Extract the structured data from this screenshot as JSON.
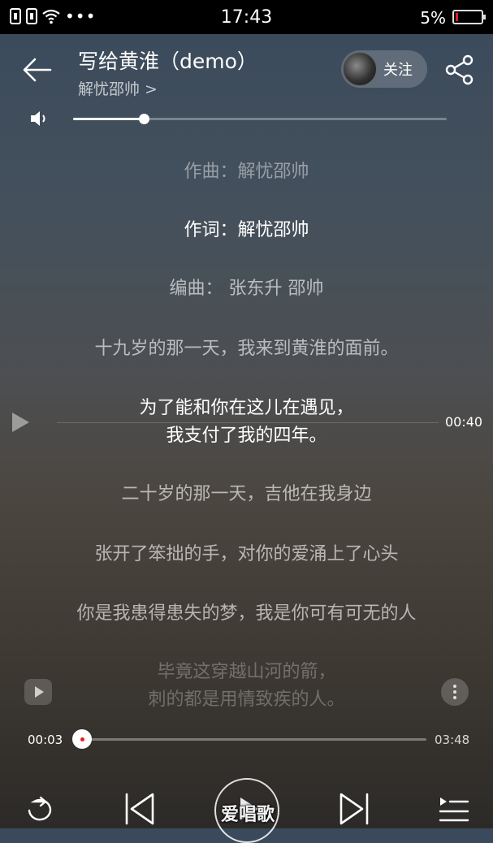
{
  "status_bar": {
    "time": "17:43",
    "battery": "5%"
  },
  "header": {
    "title": "写给黄淮（demo）",
    "artist": "解忧邵帅 >",
    "follow_label": "关注"
  },
  "volume": {
    "level_percent": 19
  },
  "lyrics": [
    {
      "text": "作曲：解忧邵帅",
      "state": "dim"
    },
    {
      "text": "作词：解忧邵帅",
      "state": "active"
    },
    {
      "text": "编曲：   张东升 邵帅",
      "state": "mid"
    },
    {
      "text": "十九岁的那一天，我来到黄淮的面前。",
      "state": "mid"
    },
    {
      "text": "为了能和你在这儿在遇见，",
      "state": "active"
    },
    {
      "text": "我支付了我的四年。",
      "state": "active"
    },
    {
      "text": "二十岁的那一天，吉他在我身边",
      "state": "mid"
    },
    {
      "text": "张开了笨拙的手，对你的爱涌上了心头",
      "state": "mid"
    },
    {
      "text": "你是我患得患失的梦，我是你可有可无的人",
      "state": "mid"
    },
    {
      "text": "毕竟这穿越山河的箭，",
      "state": "faded"
    },
    {
      "text": "刺的都是用情致疾的人。",
      "state": "faded"
    }
  ],
  "seek_indicator": {
    "time": "00:40"
  },
  "progress": {
    "current": "00:03",
    "total": "03:48",
    "fraction": 0.014
  },
  "watermark": "爱唱歌"
}
